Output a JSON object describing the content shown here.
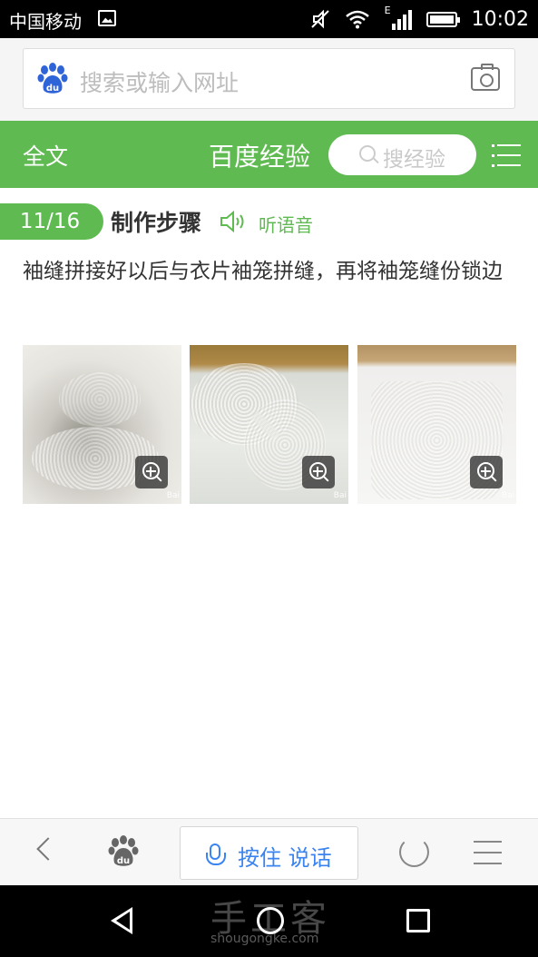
{
  "status_bar": {
    "carrier": "中国移动",
    "time": "10:02",
    "network_label": "E"
  },
  "browser": {
    "search_placeholder": "搜索或输入网址"
  },
  "header": {
    "fulltext_label": "全文",
    "title": "百度经验",
    "search_placeholder": "搜经验"
  },
  "step": {
    "badge": "11/16",
    "title": "制作步骤",
    "listen_label": "听语音",
    "body": "袖缝拼接好以后与衣片袖笼拼缝，再将袖笼缝份锁边"
  },
  "images": [
    {
      "icon": "zoom-in-icon",
      "watermark": "Bai"
    },
    {
      "icon": "zoom-in-icon",
      "watermark": "Bai"
    },
    {
      "icon": "zoom-in-icon",
      "watermark": "Bai"
    }
  ],
  "toolbar": {
    "voice_label": "按住 说话"
  },
  "watermark": {
    "site": "手工客",
    "url": "shougongke.com"
  },
  "colors": {
    "accent_green": "#5fba51",
    "voice_blue": "#3a84f2",
    "baidu_blue": "#2f63d8"
  }
}
